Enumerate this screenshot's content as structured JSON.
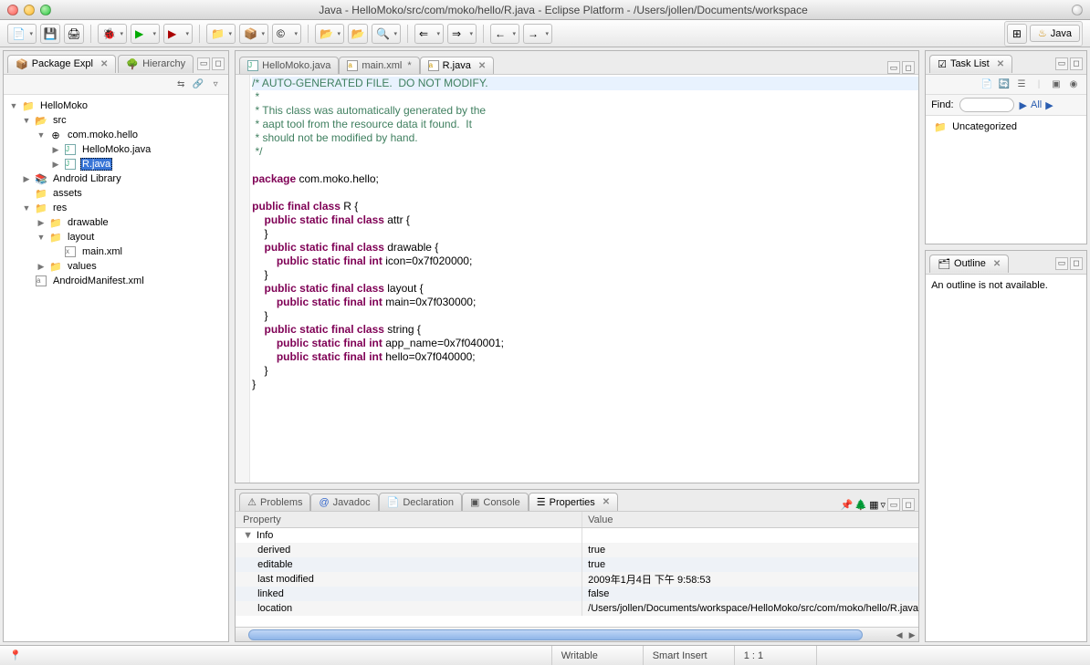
{
  "window": {
    "title": "Java - HelloMoko/src/com/moko/hello/R.java - Eclipse Platform - /Users/jollen/Documents/workspace"
  },
  "perspective": {
    "java": "Java"
  },
  "views": {
    "package_explorer": "Package Expl",
    "hierarchy": "Hierarchy",
    "task_list": "Task List",
    "outline": "Outline",
    "problems": "Problems",
    "javadoc": "Javadoc",
    "declaration": "Declaration",
    "console": "Console",
    "properties": "Properties"
  },
  "tree": {
    "project": "HelloMoko",
    "src": "src",
    "pkg": "com.moko.hello",
    "file1": "HelloMoko.java",
    "file2": "R.java",
    "android_lib": "Android Library",
    "assets": "assets",
    "res": "res",
    "drawable": "drawable",
    "layout": "layout",
    "main_xml": "main.xml",
    "values": "values",
    "manifest": "AndroidManifest.xml"
  },
  "editor_tabs": {
    "t1": "HelloMoko.java",
    "t2": "main.xml",
    "t3": "R.java"
  },
  "code": {
    "l1": "/* AUTO-GENERATED FILE.  DO NOT MODIFY.",
    "l2": " *",
    "l3": " * This class was automatically generated by the",
    "l4": " * aapt tool from the resource data it found.  It",
    "l5": " * should not be modified by hand.",
    "l6": " */",
    "l7": "",
    "pk": "package",
    "pkn": " com.moko.hello;",
    "kw_pub": "public",
    "kw_final": "final",
    "kw_class": "class",
    "kw_static": "static",
    "kw_int": "int",
    "R": " R {",
    "attr": " attr {",
    "cb": "    }",
    "drawable": " drawable {",
    "icon_l": "            ",
    "icon": " icon=0x7f020000;",
    "layout": " layout {",
    "main": " main=0x7f030000;",
    "string": " string {",
    "appn": " app_name=0x7f040001;",
    "hello": " hello=0x7f040000;",
    "cb0": "}"
  },
  "taskview": {
    "find_label": "Find:",
    "nav_all": "All",
    "uncat": "Uncategorized"
  },
  "outline": {
    "empty": "An outline is not available."
  },
  "properties": {
    "col1": "Property",
    "col2": "Value",
    "info": "Info",
    "rows": [
      {
        "k": "derived",
        "v": "true"
      },
      {
        "k": "editable",
        "v": "true"
      },
      {
        "k": "last modified",
        "v": "2009年1月4日 下午 9:58:53"
      },
      {
        "k": "linked",
        "v": "false"
      },
      {
        "k": "location",
        "v": "/Users/jollen/Documents/workspace/HelloMoko/src/com/moko/hello/R.java"
      }
    ]
  },
  "status": {
    "writable": "Writable",
    "insert": "Smart Insert",
    "pos": "1 : 1"
  }
}
